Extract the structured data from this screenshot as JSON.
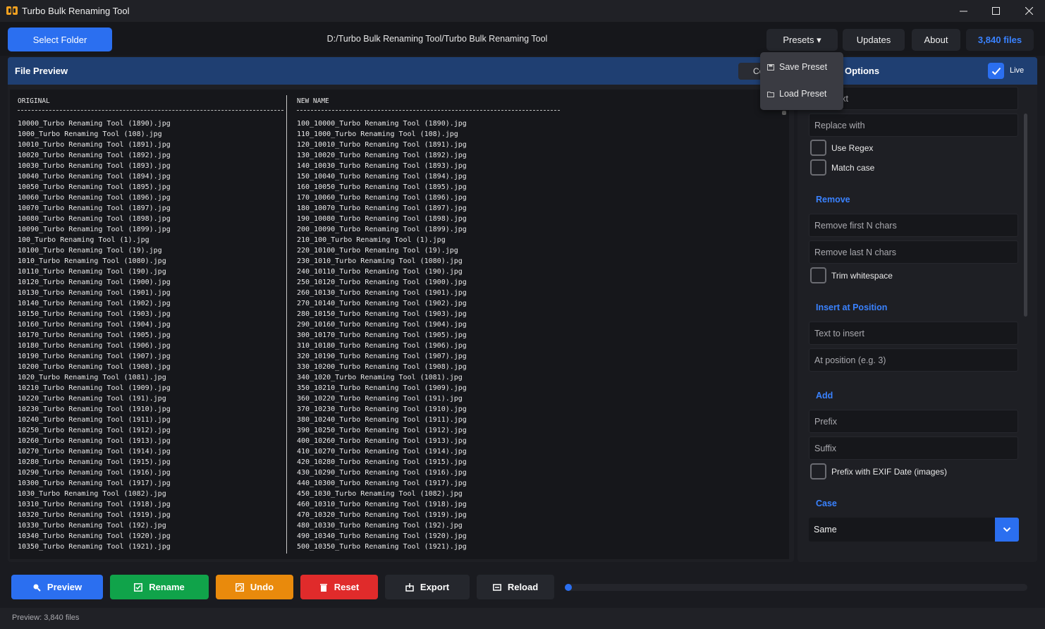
{
  "window": {
    "title": "Turbo Bulk Renaming Tool",
    "accent": "#2b6ff0"
  },
  "topbar": {
    "select_folder": "Select Folder",
    "path": "D:/Turbo Bulk Renaming Tool/Turbo Bulk Renaming Tool",
    "presets": "Presets ▾",
    "updates": "Updates",
    "about": "About",
    "file_count": "3,840 files"
  },
  "presets_menu": {
    "save": "Save Preset",
    "load": "Load Preset"
  },
  "preview": {
    "title": "File Preview",
    "copy_btn": "Copy",
    "col_original": "ORIGINAL",
    "col_new": "NEW NAME",
    "original": [
      "10000_Turbo Renaming Tool (1890).jpg",
      "1000_Turbo Renaming Tool (108).jpg",
      "10010_Turbo Renaming Tool (1891).jpg",
      "10020_Turbo Renaming Tool (1892).jpg",
      "10030_Turbo Renaming Tool (1893).jpg",
      "10040_Turbo Renaming Tool (1894).jpg",
      "10050_Turbo Renaming Tool (1895).jpg",
      "10060_Turbo Renaming Tool (1896).jpg",
      "10070_Turbo Renaming Tool (1897).jpg",
      "10080_Turbo Renaming Tool (1898).jpg",
      "10090_Turbo Renaming Tool (1899).jpg",
      "100_Turbo Renaming Tool (1).jpg",
      "10100_Turbo Renaming Tool (19).jpg",
      "1010_Turbo Renaming Tool (1080).jpg",
      "10110_Turbo Renaming Tool (190).jpg",
      "10120_Turbo Renaming Tool (1900).jpg",
      "10130_Turbo Renaming Tool (1901).jpg",
      "10140_Turbo Renaming Tool (1902).jpg",
      "10150_Turbo Renaming Tool (1903).jpg",
      "10160_Turbo Renaming Tool (1904).jpg",
      "10170_Turbo Renaming Tool (1905).jpg",
      "10180_Turbo Renaming Tool (1906).jpg",
      "10190_Turbo Renaming Tool (1907).jpg",
      "10200_Turbo Renaming Tool (1908).jpg",
      "1020_Turbo Renaming Tool (1081).jpg",
      "10210_Turbo Renaming Tool (1909).jpg",
      "10220_Turbo Renaming Tool (191).jpg",
      "10230_Turbo Renaming Tool (1910).jpg",
      "10240_Turbo Renaming Tool (1911).jpg",
      "10250_Turbo Renaming Tool (1912).jpg",
      "10260_Turbo Renaming Tool (1913).jpg",
      "10270_Turbo Renaming Tool (1914).jpg",
      "10280_Turbo Renaming Tool (1915).jpg",
      "10290_Turbo Renaming Tool (1916).jpg",
      "10300_Turbo Renaming Tool (1917).jpg",
      "1030_Turbo Renaming Tool (1082).jpg",
      "10310_Turbo Renaming Tool (1918).jpg",
      "10320_Turbo Renaming Tool (1919).jpg",
      "10330_Turbo Renaming Tool (192).jpg",
      "10340_Turbo Renaming Tool (1920).jpg",
      "10350_Turbo Renaming Tool (1921).jpg"
    ],
    "new_names": [
      "100_10000_Turbo Renaming Tool (1890).jpg",
      "110_1000_Turbo Renaming Tool (108).jpg",
      "120_10010_Turbo Renaming Tool (1891).jpg",
      "130_10020_Turbo Renaming Tool (1892).jpg",
      "140_10030_Turbo Renaming Tool (1893).jpg",
      "150_10040_Turbo Renaming Tool (1894).jpg",
      "160_10050_Turbo Renaming Tool (1895).jpg",
      "170_10060_Turbo Renaming Tool (1896).jpg",
      "180_10070_Turbo Renaming Tool (1897).jpg",
      "190_10080_Turbo Renaming Tool (1898).jpg",
      "200_10090_Turbo Renaming Tool (1899).jpg",
      "210_100_Turbo Renaming Tool (1).jpg",
      "220_10100_Turbo Renaming Tool (19).jpg",
      "230_1010_Turbo Renaming Tool (1080).jpg",
      "240_10110_Turbo Renaming Tool (190).jpg",
      "250_10120_Turbo Renaming Tool (1900).jpg",
      "260_10130_Turbo Renaming Tool (1901).jpg",
      "270_10140_Turbo Renaming Tool (1902).jpg",
      "280_10150_Turbo Renaming Tool (1903).jpg",
      "290_10160_Turbo Renaming Tool (1904).jpg",
      "300_10170_Turbo Renaming Tool (1905).jpg",
      "310_10180_Turbo Renaming Tool (1906).jpg",
      "320_10190_Turbo Renaming Tool (1907).jpg",
      "330_10200_Turbo Renaming Tool (1908).jpg",
      "340_1020_Turbo Renaming Tool (1081).jpg",
      "350_10210_Turbo Renaming Tool (1909).jpg",
      "360_10220_Turbo Renaming Tool (191).jpg",
      "370_10230_Turbo Renaming Tool (1910).jpg",
      "380_10240_Turbo Renaming Tool (1911).jpg",
      "390_10250_Turbo Renaming Tool (1912).jpg",
      "400_10260_Turbo Renaming Tool (1913).jpg",
      "410_10270_Turbo Renaming Tool (1914).jpg",
      "420_10280_Turbo Renaming Tool (1915).jpg",
      "430_10290_Turbo Renaming Tool (1916).jpg",
      "440_10300_Turbo Renaming Tool (1917).jpg",
      "450_1030_Turbo Renaming Tool (1082).jpg",
      "460_10310_Turbo Renaming Tool (1918).jpg",
      "470_10320_Turbo Renaming Tool (1919).jpg",
      "480_10330_Turbo Renaming Tool (192).jpg",
      "490_10340_Turbo Renaming Tool (1920).jpg",
      "500_10350_Turbo Renaming Tool (1921).jpg"
    ]
  },
  "options": {
    "title": "Options",
    "live_label": "Live",
    "live_checked": true,
    "find_placeholder": "Find text",
    "replace_placeholder": "Replace with",
    "use_regex": "Use Regex",
    "match_case": "Match case",
    "remove_title": "Remove",
    "remove_first": "Remove first N chars",
    "remove_last": "Remove last N chars",
    "trim_whitespace": "Trim whitespace",
    "insert_title": "Insert at Position",
    "text_to_insert": "Text to insert",
    "at_position": "At position (e.g. 3)",
    "add_title": "Add",
    "prefix": "Prefix",
    "suffix": "Suffix",
    "exif_prefix": "Prefix with EXIF Date (images)",
    "case_title": "Case",
    "case_value": "Same"
  },
  "actions": {
    "preview": "Preview",
    "rename": "Rename",
    "undo": "Undo",
    "reset": "Reset",
    "export": "Export",
    "reload": "Reload",
    "colors": {
      "preview": "#2b6ff0",
      "rename": "#10a34a",
      "undo": "#e98a0c",
      "reset": "#e02b2b",
      "neutral": "#25272d"
    },
    "progress": 0
  },
  "status": {
    "text": "Preview: 3,840 files"
  }
}
